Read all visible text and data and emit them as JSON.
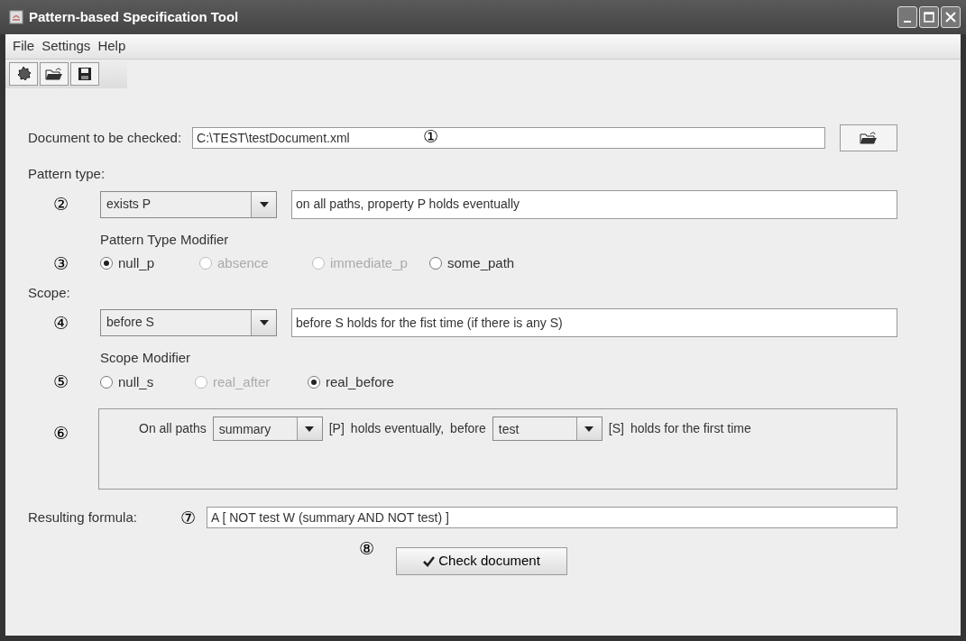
{
  "window": {
    "title": "Pattern-based Specification Tool"
  },
  "menu": [
    "File",
    "Settings",
    "Help"
  ],
  "toolbar": [
    {
      "kind": "new"
    },
    {
      "kind": "open"
    },
    {
      "kind": "save"
    }
  ],
  "document": {
    "label": "Document to be checked:",
    "value": "C:\\TEST\\testDocument.xml",
    "marker": "①"
  },
  "pattern_type": {
    "label": "Pattern type:",
    "marker": "②",
    "value": "exists P",
    "description": "on all paths, property P holds eventually"
  },
  "pattern_type_modifier": {
    "title": "Pattern Type Modifier",
    "marker": "③",
    "options": [
      {
        "label": "null_p",
        "selected": true,
        "disabled": false
      },
      {
        "label": "absence",
        "selected": false,
        "disabled": true
      },
      {
        "label": "immediate_p",
        "selected": false,
        "disabled": true
      },
      {
        "label": "some_path",
        "selected": false,
        "disabled": false
      }
    ]
  },
  "scope": {
    "label": "Scope:",
    "marker": "④",
    "value": "before S",
    "description": "before S holds for the fist time (if there is any S)"
  },
  "scope_modifier": {
    "title": "Scope Modifier",
    "marker": "⑤",
    "options": [
      {
        "label": "null_s",
        "selected": false,
        "disabled": false
      },
      {
        "label": "real_after",
        "selected": false,
        "disabled": true
      },
      {
        "label": "real_before",
        "selected": true,
        "disabled": false
      }
    ]
  },
  "sentence": {
    "marker": "⑥",
    "parts": [
      {
        "kind": "text",
        "text": "On all paths"
      },
      {
        "kind": "combo",
        "value": "summary"
      },
      {
        "kind": "text",
        "text": "[P]"
      },
      {
        "kind": "text",
        "text": "holds eventually,"
      },
      {
        "kind": "text",
        "text": "before"
      },
      {
        "kind": "combo",
        "value": "test"
      },
      {
        "kind": "text",
        "text": "[S]"
      },
      {
        "kind": "text",
        "text": "holds for the first time"
      }
    ]
  },
  "formula": {
    "label": "Resulting formula:",
    "marker": "⑦",
    "value": "A [ NOT test W (summary AND NOT test) ]"
  },
  "check_button": {
    "label": "Check document",
    "marker": "⑧"
  }
}
